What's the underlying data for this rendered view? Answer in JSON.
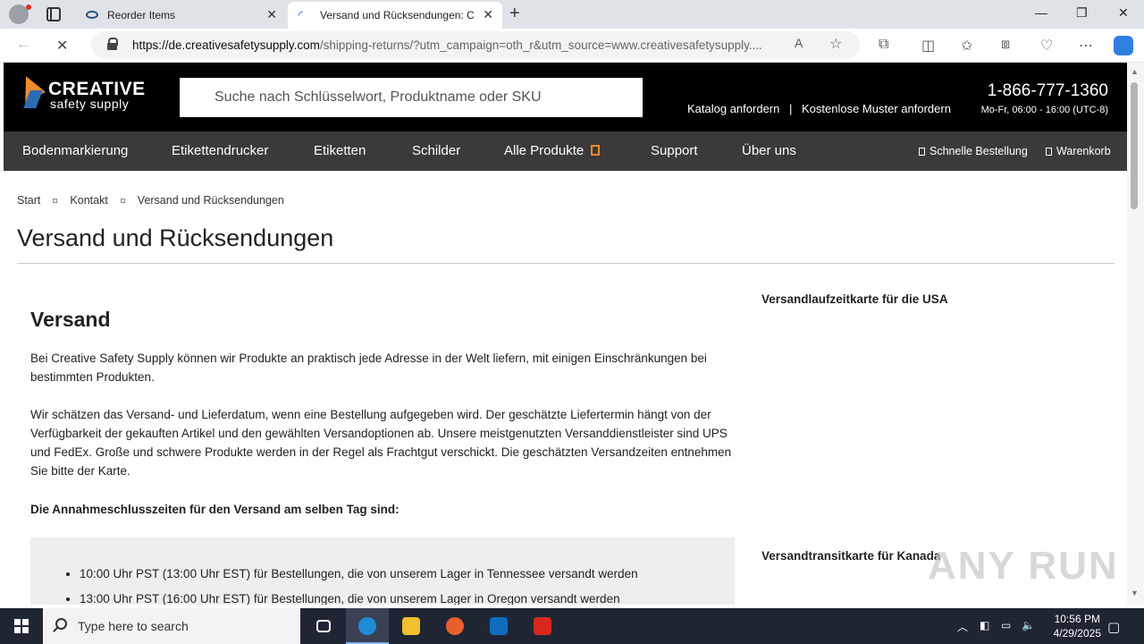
{
  "browser": {
    "tabs": [
      {
        "title": "Reorder Items"
      },
      {
        "title": "Versand und Rücksendungen: Cr"
      }
    ],
    "url_host": "https://de.creativesafetysupply.com",
    "url_path": "/shipping-returns/?utm_campaign=oth_r&utm_source=www.creativesafetysupply...."
  },
  "site": {
    "logo_line1": "CREATIVE",
    "logo_line2": "safety supply",
    "search_placeholder": "Suche nach Schlüsselwort, Produktname oder SKU",
    "links": [
      "Katalog anfordern",
      "|",
      "Kostenlose Muster anfordern"
    ],
    "phone": "1-866-777-1360",
    "hours": "Mo-Fr, 06:00 - 16:00 (UTC-8)"
  },
  "nav": {
    "items": [
      "Bodenmarkierung",
      "Etikettendrucker",
      "Etiketten",
      "Schilder",
      "Alle Produkte",
      "Support",
      "Über uns"
    ],
    "quick_order": "Schnelle Bestellung",
    "cart": "Warenkorb"
  },
  "breadcrumbs": [
    "Start",
    "Kontakt",
    "Versand und Rücksendungen"
  ],
  "page": {
    "title": "Versand und Rücksendungen",
    "section_title": "Versand",
    "para1": "Bei Creative Safety Supply können wir Produkte an praktisch jede Adresse in der Welt liefern, mit einigen Einschränkungen bei bestimmten Produkten.",
    "para2": "Wir schätzen das Versand- und Lieferdatum, wenn eine Bestellung aufgegeben wird. Der geschätzte Liefertermin hängt von der Verfügbarkeit der gekauften Artikel und den gewählten Versandoptionen ab. Unsere meistgenutzten Versanddienstleister sind UPS und FedEx. Große und schwere Produkte werden in der Regel als Frachtgut verschickt. Die geschätzten Versandzeiten entnehmen Sie bitte der Karte.",
    "cutoff_heading": "Die Annahmeschlusszeiten für den Versand am selben Tag sind:",
    "cutoffs": [
      "10:00 Uhr PST (13:00 Uhr EST) für Bestellungen, die von unserem Lager in Tennessee versandt werden",
      "13:00 Uhr PST (16:00 Uhr EST) für Bestellungen, die von unserem Lager in Oregon versandt werden"
    ],
    "side_heading_usa": "Versandlaufzeitkarte für die USA",
    "side_heading_canada": "Versandtransitkarte für Kanada"
  },
  "watermark": "ANY RUN",
  "taskbar": {
    "search_placeholder": "Type here to search",
    "time": "10:56 PM",
    "date": "4/29/2025"
  },
  "colors": {
    "header_bg": "#000000",
    "nav_bg": "#3a3a3a",
    "accent_orange": "#f28c28",
    "logo_blue": "#2b6cb5"
  }
}
